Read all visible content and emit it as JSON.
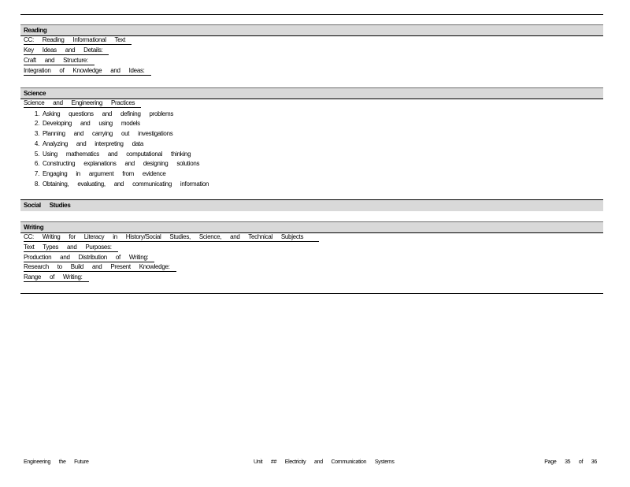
{
  "sections": {
    "reading": {
      "title": "Reading",
      "links": [
        "CC: Reading Informational Text",
        "Key Ideas and Details:",
        "Craft and Structure:",
        "Integration of Knowledge and Ideas:"
      ]
    },
    "science": {
      "title": "Science",
      "link": "Science and Engineering Practices",
      "practices": [
        {
          "num": "1.",
          "text": "Asking questions and defining problems"
        },
        {
          "num": "2.",
          "text": "Developing and using models"
        },
        {
          "num": "3.",
          "text": "Planning and carrying out investigations"
        },
        {
          "num": "4.",
          "text": "Analyzing and interpreting data"
        },
        {
          "num": "5.",
          "text": "Using mathematics and computational thinking"
        },
        {
          "num": "6.",
          "text": "Constructing explanations and designing solutions"
        },
        {
          "num": "7.",
          "text": "Engaging in argument from evidence"
        },
        {
          "num": "8.",
          "text": "Obtaining, evaluating, and communicating information"
        }
      ]
    },
    "social": {
      "title": "Social Studies"
    },
    "writing": {
      "title": "Writing",
      "links": [
        "CC: Writing for Literacy in History/Social Studies, Science, and Technical Subjects",
        "Text Types and Purposes:",
        "Production and Distribution of Writing:",
        "Research to Build and Present Knowledge:",
        "Range of Writing:"
      ]
    }
  },
  "footer": {
    "left": "Engineering the Future",
    "center": "Unit ## Electricity and Communication Systems",
    "right": "Page 35 of 36"
  }
}
